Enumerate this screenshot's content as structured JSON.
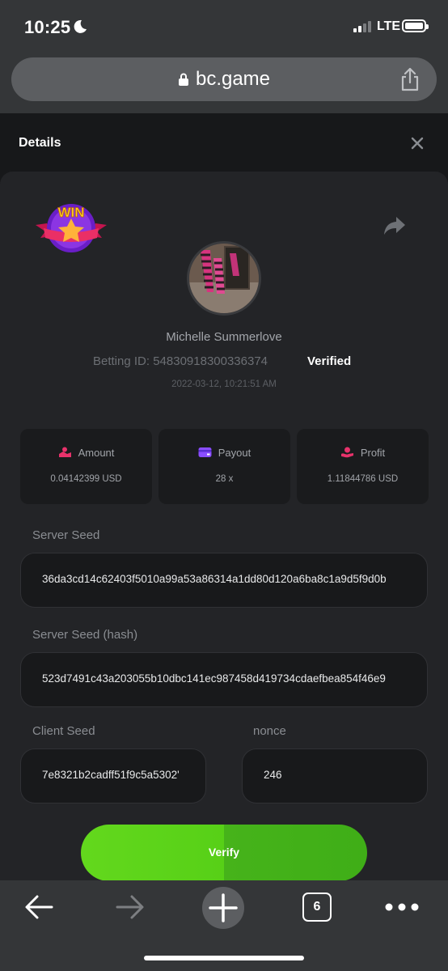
{
  "status_bar": {
    "time": "10:25",
    "network": "LTE"
  },
  "browser": {
    "url": "bc.game",
    "tab_count": "6"
  },
  "modal": {
    "title": "Details",
    "badge_text": "WIN",
    "username": "Michelle Summerlove",
    "betting_id": "Betting ID: 54830918300336374",
    "verified_label": "Verified",
    "timestamp": "2022-03-12, 10:21:51 AM"
  },
  "stats": [
    {
      "label": "Amount",
      "value": "0.04142399 USD",
      "icon": "amount-icon",
      "color": "#e8326b"
    },
    {
      "label": "Payout",
      "value": "28 x",
      "icon": "payout-icon",
      "color": "#8a4dff"
    },
    {
      "label": "Profit",
      "value": "1.11844786 USD",
      "icon": "profit-icon",
      "color": "#e8326b"
    }
  ],
  "seeds": {
    "server_seed_label": "Server Seed",
    "server_seed": "36da3cd14c62403f5010a99a53a86314a1dd80d120a6ba8c1a9d5f9d0b",
    "server_hash_label": "Server Seed (hash)",
    "server_hash": "523d7491c43a203055b10dbc141ec987458d419734cdaefbea854f46e9",
    "client_seed_label": "Client Seed",
    "client_seed": "7e8321b2cadff51f9c5a5302'",
    "nonce_label": "nonce",
    "nonce": "246"
  },
  "verify_label": "Verify",
  "colors": {
    "accent_green": "#5bd21b",
    "panel": "#232427",
    "background": "#17181a"
  }
}
